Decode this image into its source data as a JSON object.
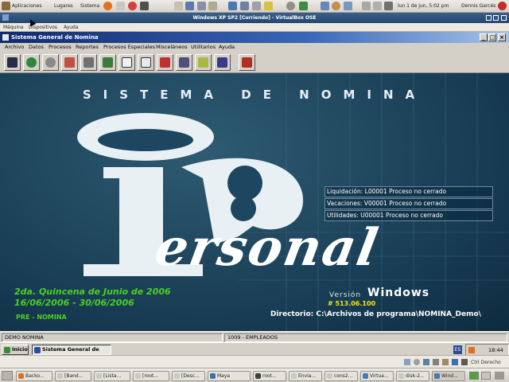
{
  "gnome_top": {
    "menus": [
      "Aplicaciones",
      "Lugares",
      "Sistema"
    ],
    "clock": "lun 1 de jun, 5:02 pm",
    "user": "Dennis Garcés"
  },
  "vbox": {
    "title": "Windows XP SP2 [Corriendo] - VirtualBox OSE",
    "menu": [
      "Máquina",
      "Dispositivos",
      "Ayuda"
    ]
  },
  "app": {
    "title": "Sistema General de Nomina",
    "window_buttons": [
      "_",
      "□",
      "×"
    ],
    "menu": [
      "Archivo",
      "Datos",
      "Procesos",
      "Reportes",
      "Procesos Especiales",
      "Misceláneos",
      "Utilitarios",
      "Ayuda"
    ],
    "toolbar_icons": [
      "app-icon",
      "globe-icon",
      "stopwatch-icon",
      "tools-icon",
      "calculator-icon",
      "calendar-icon",
      "document-icon",
      "search-doc-icon",
      "network-icon",
      "people-icon",
      "certificate-icon",
      "database-icon",
      "exit-door-icon"
    ]
  },
  "splash": {
    "banner": "SISTEMA DE NOMINA",
    "logo_text": "ersonal",
    "status_rows": [
      "Liquidación: L00001 Proceso no cerrado",
      "Vacaciones: V00001 Proceso no cerrado",
      "Utilidades: U00001 Proceso no cerrado"
    ],
    "period_line1": "2da. Quincena de Junio de 2006",
    "period_line2": "16/06/2006 - 30/06/2006",
    "pre_label": "PRE - NOMINA",
    "version_label": "Versión",
    "version_name": "Windows",
    "version_number": "# 513.06.100",
    "directory": "Directorio: C:\\Archivos de programa\\NOMINA_Demo\\"
  },
  "status_bar": {
    "company": "DEMO NOMINA",
    "employees": "1009 - EMPLEADOS"
  },
  "xp_taskbar": {
    "start": "Inicio",
    "task": "Sistema General de N...",
    "lang": "ES",
    "clock": "18:44"
  },
  "host_status": {
    "hotkey": "Ctrl Derecho"
  },
  "gnome_bottom": {
    "tasks": [
      "Backo...",
      "[Band...",
      "[Lista...",
      "[root...",
      "[Desc...",
      "Maya",
      "root...",
      "Envia...",
      "cons2...",
      "Virtua...",
      "disk-2...",
      "Wind..."
    ]
  },
  "colors": {
    "splash_bg": "#1d4660",
    "accent_green": "#4cd21e",
    "version_yellow": "#f4e21a"
  }
}
